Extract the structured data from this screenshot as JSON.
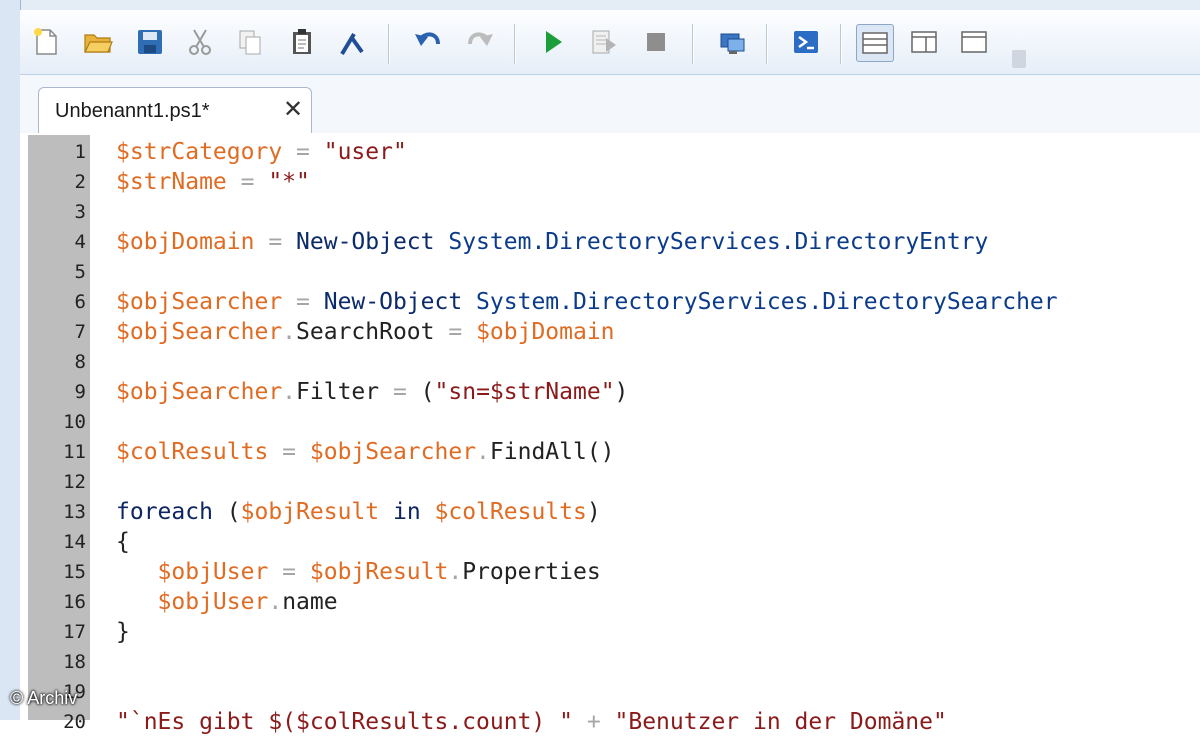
{
  "toolbar": {
    "buttons": [
      {
        "name": "new-file",
        "icon": "new-file-icon"
      },
      {
        "name": "open",
        "icon": "folder-open-icon"
      },
      {
        "name": "save",
        "icon": "save-disk-icon"
      },
      {
        "name": "cut",
        "icon": "scissors-icon"
      },
      {
        "name": "copy",
        "icon": "copy-icon"
      },
      {
        "name": "paste",
        "icon": "clipboard-icon"
      },
      {
        "name": "clear",
        "icon": "broom-icon"
      },
      {
        "name": "undo",
        "icon": "undo-arrow-icon"
      },
      {
        "name": "redo",
        "icon": "redo-arrow-icon"
      },
      {
        "name": "run",
        "icon": "play-icon"
      },
      {
        "name": "run-selection",
        "icon": "run-selection-icon"
      },
      {
        "name": "stop",
        "icon": "stop-icon"
      },
      {
        "name": "remote",
        "icon": "remote-session-icon"
      },
      {
        "name": "powershell",
        "icon": "powershell-icon"
      },
      {
        "name": "layout-top",
        "icon": "layout-top-icon"
      },
      {
        "name": "layout-right",
        "icon": "layout-right-icon"
      },
      {
        "name": "layout-max",
        "icon": "layout-maximize-icon"
      }
    ]
  },
  "tab": {
    "title": "Unbenannt1.ps1*",
    "close": "✕"
  },
  "editor": {
    "line_numbers": [
      "1",
      "2",
      "3",
      "4",
      "5",
      "6",
      "7",
      "8",
      "9",
      "10",
      "11",
      "12",
      "13",
      "14",
      "15",
      "16",
      "17",
      "18",
      "19",
      "20"
    ],
    "lines": [
      [
        {
          "t": "$strCategory",
          "c": "v"
        },
        {
          "t": " = ",
          "c": "op"
        },
        {
          "t": "\"user\"",
          "c": "s"
        }
      ],
      [
        {
          "t": "$strName",
          "c": "v"
        },
        {
          "t": " = ",
          "c": "op"
        },
        {
          "t": "\"*\"",
          "c": "s"
        }
      ],
      [],
      [
        {
          "t": "$objDomain",
          "c": "v"
        },
        {
          "t": " = ",
          "c": "op"
        },
        {
          "t": "New-Object",
          "c": "c"
        },
        {
          "t": " System.DirectoryServices.DirectoryEntry",
          "c": "t"
        }
      ],
      [],
      [
        {
          "t": "$objSearcher",
          "c": "v"
        },
        {
          "t": " = ",
          "c": "op"
        },
        {
          "t": "New-Object",
          "c": "c"
        },
        {
          "t": " System.DirectoryServices.DirectorySearcher",
          "c": "t"
        }
      ],
      [
        {
          "t": "$objSearcher",
          "c": "v"
        },
        {
          "t": ".",
          "c": "op"
        },
        {
          "t": "SearchRoot",
          "c": "p"
        },
        {
          "t": " = ",
          "c": "op"
        },
        {
          "t": "$objDomain",
          "c": "v"
        }
      ],
      [],
      [
        {
          "t": "$objSearcher",
          "c": "v"
        },
        {
          "t": ".",
          "c": "op"
        },
        {
          "t": "Filter",
          "c": "p"
        },
        {
          "t": " = ",
          "c": "op"
        },
        {
          "t": "(",
          "c": "p"
        },
        {
          "t": "\"sn=$strName\"",
          "c": "s"
        },
        {
          "t": ")",
          "c": "p"
        }
      ],
      [],
      [
        {
          "t": "$colResults",
          "c": "v"
        },
        {
          "t": " = ",
          "c": "op"
        },
        {
          "t": "$objSearcher",
          "c": "v"
        },
        {
          "t": ".",
          "c": "op"
        },
        {
          "t": "FindAll()",
          "c": "p"
        }
      ],
      [],
      [
        {
          "t": "foreach",
          "c": "k"
        },
        {
          "t": " (",
          "c": "p"
        },
        {
          "t": "$objResult",
          "c": "v"
        },
        {
          "t": " in ",
          "c": "k"
        },
        {
          "t": "$colResults",
          "c": "v"
        },
        {
          "t": ")",
          "c": "p"
        }
      ],
      [
        {
          "t": "{",
          "c": "p"
        }
      ],
      [
        {
          "t": "   ",
          "c": "p"
        },
        {
          "t": "$objUser",
          "c": "v"
        },
        {
          "t": " = ",
          "c": "op"
        },
        {
          "t": "$objResult",
          "c": "v"
        },
        {
          "t": ".",
          "c": "op"
        },
        {
          "t": "Properties",
          "c": "p"
        }
      ],
      [
        {
          "t": "   ",
          "c": "p"
        },
        {
          "t": "$objUser",
          "c": "v"
        },
        {
          "t": ".",
          "c": "op"
        },
        {
          "t": "name",
          "c": "p"
        }
      ],
      [
        {
          "t": "}",
          "c": "p"
        }
      ],
      [],
      [],
      [
        {
          "t": "\"`nEs gibt $($colResults.count) \"",
          "c": "s"
        },
        {
          "t": " + ",
          "c": "op"
        },
        {
          "t": "\"Benutzer in der Domäne\"",
          "c": "s"
        }
      ]
    ]
  },
  "watermark": "© Archiv"
}
